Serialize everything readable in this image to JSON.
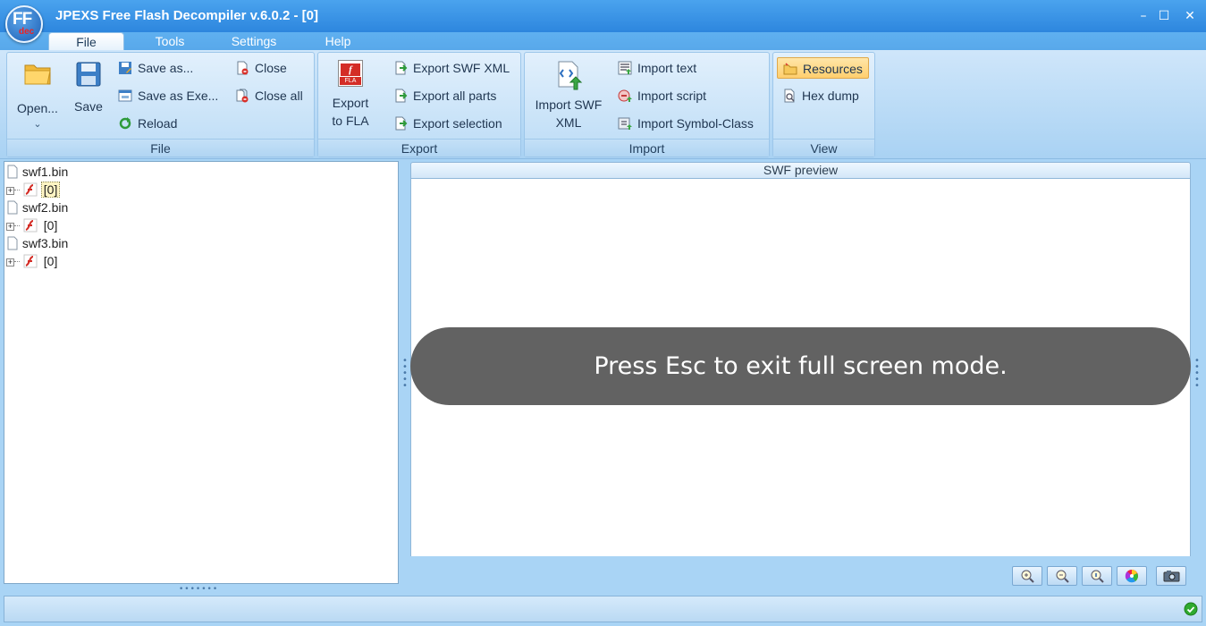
{
  "window": {
    "title": "JPEXS Free Flash Decompiler v.6.0.2 - [0]",
    "logo_main": "FF",
    "logo_sub": "dec",
    "minimize_icon": "minimize-icon",
    "maximize_icon": "maximize-icon",
    "close_icon": "close-icon"
  },
  "menu": {
    "tabs": [
      {
        "label": "File",
        "active": true
      },
      {
        "label": "Tools",
        "active": false
      },
      {
        "label": "Settings",
        "active": false
      },
      {
        "label": "Help",
        "active": false
      }
    ]
  },
  "ribbon": {
    "file_group": {
      "label": "File",
      "open": "Open...",
      "save": "Save",
      "save_as": "Save as...",
      "save_as_exe": "Save as Exe...",
      "reload": "Reload",
      "close": "Close",
      "close_all": "Close all"
    },
    "export_group": {
      "label": "Export",
      "export_fla_line1": "Export",
      "export_fla_line2": "to FLA",
      "fla_badge": "FLA",
      "export_swf_xml": "Export SWF XML",
      "export_all_parts": "Export all parts",
      "export_selection": "Export selection"
    },
    "import_group": {
      "label": "Import",
      "import_swf_xml_line1": "Import SWF",
      "import_swf_xml_line2": "XML",
      "import_text": "Import text",
      "import_script": "Import script",
      "import_symbol_class": "Import Symbol-Class"
    },
    "view_group": {
      "label": "View",
      "resources": "Resources",
      "hex_dump": "Hex dump"
    }
  },
  "tree": {
    "items": [
      {
        "file": "swf1.bin",
        "child": "[0]",
        "selected": true
      },
      {
        "file": "swf2.bin",
        "child": "[0]",
        "selected": false
      },
      {
        "file": "swf3.bin",
        "child": "[0]",
        "selected": false
      }
    ]
  },
  "preview": {
    "header": "SWF preview",
    "fullscreen_message": "Press Esc to exit full screen mode."
  },
  "colors": {
    "title_bar": "#2d86de",
    "ribbon": "#bcdcf6",
    "fullscreen_overlay": "#626262",
    "status_ok": "#2eaa2e"
  }
}
